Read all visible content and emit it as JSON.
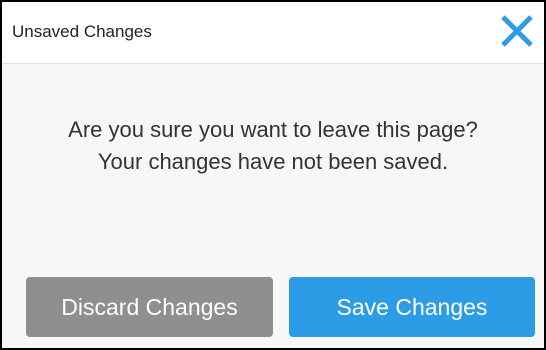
{
  "dialog": {
    "title": "Unsaved Changes",
    "close_icon": "close-x-icon",
    "message_line1": "Are you sure you want to leave this page?",
    "message_line2": "Your changes have not been saved.",
    "discard_label": "Discard Changes",
    "save_label": "Save Changes"
  },
  "colors": {
    "accent": "#2d9ce6",
    "discard_button": "#8f8f8f",
    "body_background": "#f6f7f6",
    "header_background": "#ffffff",
    "border": "#000000"
  }
}
